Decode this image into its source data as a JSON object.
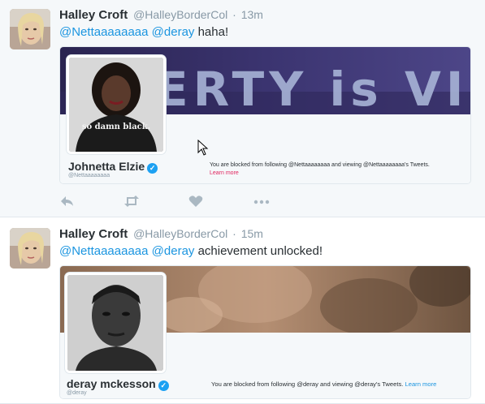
{
  "tweets": [
    {
      "author_name": "Halley Croft",
      "author_handle": "@HalleyBorderCol",
      "separator": "·",
      "time": "13m",
      "mention1": "@Nettaaaaaaaa",
      "mention2": "@deray",
      "body": " haha!",
      "card": {
        "name": "Johnetta Elzie",
        "handle": "@Nettaaaaaaaa",
        "blocked_text": "You are blocked from following @Nettaaaaaaaa and viewing @Nettaaaaaaaa's Tweets.",
        "learn_more": "Learn more",
        "banner_text": "ERTY is VIO",
        "photo_text": "so damn black."
      },
      "actions": {
        "reply_icon": "reply-icon",
        "retweet_icon": "retweet-icon",
        "like_icon": "heart-icon",
        "more_icon": "more-icon"
      }
    },
    {
      "author_name": "Halley Croft",
      "author_handle": "@HalleyBorderCol",
      "separator": "·",
      "time": "15m",
      "mention1": "@Nettaaaaaaaa",
      "mention2": "@deray",
      "body": " achievement unlocked!",
      "card": {
        "name": "deray mckesson",
        "handle": "@deray",
        "blocked_text": "You are blocked from following @deray and viewing @deray's Tweets.",
        "learn_more": "Learn more"
      }
    }
  ],
  "colors": {
    "link": "#1b95e0",
    "muted": "#8899a6",
    "verified": "#1da1f2",
    "learn_more_1": "#e0245e"
  }
}
